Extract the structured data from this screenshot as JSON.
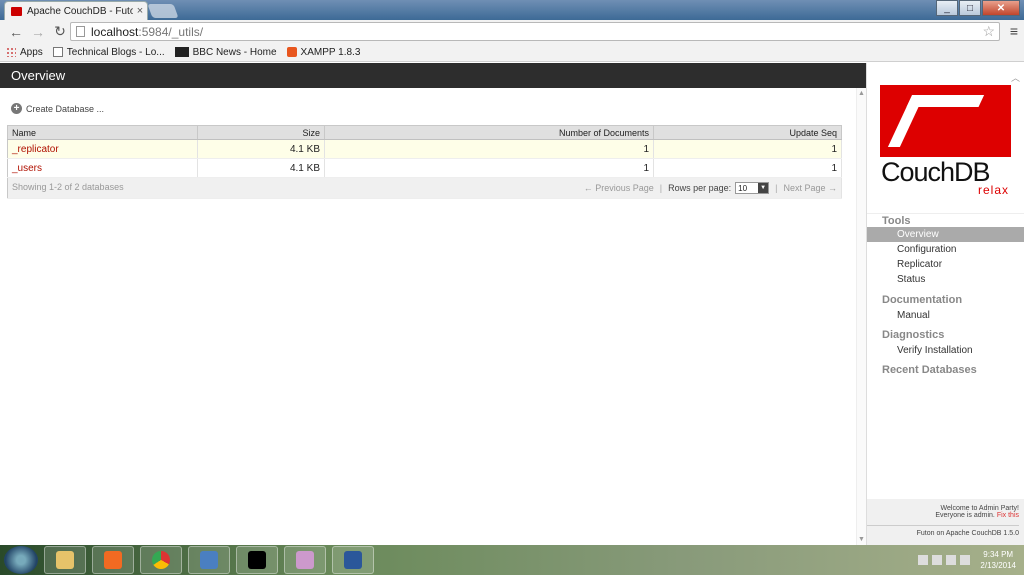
{
  "browser": {
    "tab_title": "Apache CouchDB - Futon",
    "tab_close": "×",
    "window_controls": {
      "minimize": "_",
      "maximize": "□",
      "close": "✕"
    },
    "url_host": "localhost",
    "url_rest": ":5984/_utils/",
    "bookmarks": [
      {
        "label": "Apps",
        "icon": "apps-icon"
      },
      {
        "label": "Technical Blogs - Lo...",
        "icon": "document-icon"
      },
      {
        "label": "BBC News - Home",
        "icon": "bbc-icon"
      },
      {
        "label": "XAMPP 1.8.3",
        "icon": "xampp-icon"
      }
    ]
  },
  "header": {
    "title": "Overview"
  },
  "toolbar": {
    "create_db": "Create Database ..."
  },
  "table": {
    "columns": [
      "Name",
      "Size",
      "Number of Documents",
      "Update Seq"
    ],
    "rows": [
      {
        "name": "_replicator",
        "size": "4.1 KB",
        "docs": "1",
        "seq": "1"
      },
      {
        "name": "_users",
        "size": "4.1 KB",
        "docs": "1",
        "seq": "1"
      }
    ],
    "footer": {
      "showing": "Showing 1-2 of 2 databases",
      "prev": "← Previous Page",
      "rows_per_page": "Rows per page:",
      "rows_value": "10",
      "next": "Next Page →",
      "sep": "|"
    }
  },
  "sidebar": {
    "logo_text": "CouchDB",
    "logo_sub": "relax",
    "tools_head": "Tools",
    "tools": [
      "Overview",
      "Configuration",
      "Replicator",
      "Status"
    ],
    "docs_head": "Documentation",
    "docs": [
      "Manual"
    ],
    "diag_head": "Diagnostics",
    "diag": [
      "Verify Installation"
    ],
    "recent_head": "Recent Databases",
    "footer_line1": "Welcome to Admin Party!",
    "footer_line2": "Everyone is admin.",
    "footer_fix": "Fix this",
    "footer_version": "Futon on Apache CouchDB 1.5.0"
  },
  "taskbar": {
    "time": "9:34 PM",
    "date": "2/13/2014"
  },
  "colors": {
    "accent": "#b01000",
    "header_bg": "#2d2d2d",
    "logo_red": "#dd0000"
  }
}
